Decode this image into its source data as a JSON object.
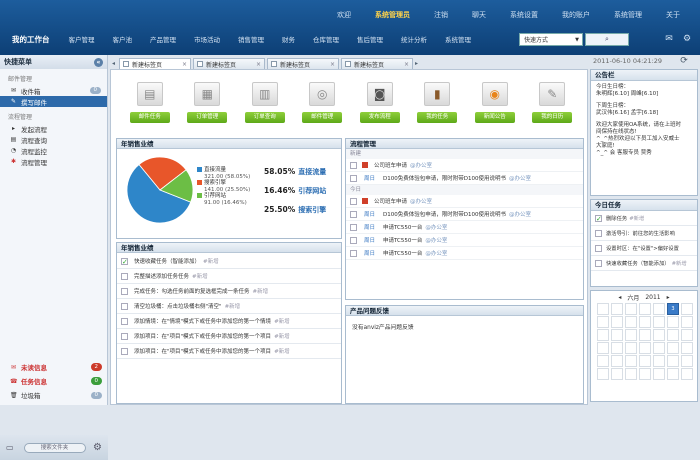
{
  "header": {
    "links": [
      "欢迎",
      "系统管理员",
      "注销",
      "聊天",
      "系统设置",
      "我的账户",
      "系统管理",
      "关于"
    ],
    "home_label": "我的工作台",
    "nav": [
      "客户管理",
      "客户池",
      "产品管理",
      "市场活动",
      "销售管理",
      "财务",
      "仓库管理",
      "售后管理",
      "统计分析",
      "系统管理"
    ],
    "search_mode": "快速方式"
  },
  "sidebar": {
    "title": "快捷菜单",
    "sections": [
      {
        "label": "邮件管理",
        "items": [
          {
            "label": "收件箱",
            "count": "0"
          },
          {
            "label": "撰写邮件"
          }
        ]
      },
      {
        "label": "流程管理",
        "items": [
          {
            "label": "发起流程"
          },
          {
            "label": "流程查询"
          },
          {
            "label": "流程监控"
          },
          {
            "label": "流程管理"
          }
        ]
      }
    ],
    "bottom": [
      {
        "label": "未读信息",
        "count": "2",
        "color": "#cc3a2a"
      },
      {
        "label": "任务信息",
        "count": "0",
        "color": "#3b9e3b"
      },
      {
        "label": "垃圾箱",
        "count": "0"
      }
    ],
    "foot_pill": "搜索文件夹"
  },
  "tabs": [
    "新建标签页",
    "新建标签页",
    "新建标签页",
    "新建标签页"
  ],
  "datetime": "2011-06-10 04:21:29",
  "quick_actions": [
    "邮件任务",
    "订单管理",
    "订单查询",
    "邮件管理",
    "发布流程",
    "我的任务",
    "新闻公告",
    "我的日历"
  ],
  "sales_panel": {
    "title": "年销售业绩",
    "legend": [
      {
        "name": "直接流量",
        "sub": "321.00 (58.05%)"
      },
      {
        "name": "搜索引擎",
        "sub": "141.00 (25.50%)"
      },
      {
        "name": "引荐网站",
        "sub": "91.00 (16.46%)"
      }
    ],
    "stats": [
      {
        "pct": "58.05%",
        "label": "直接流量"
      },
      {
        "pct": "16.46%",
        "label": "引荐网站"
      },
      {
        "pct": "25.50%",
        "label": "搜索引擎"
      }
    ]
  },
  "chart_data": {
    "type": "pie",
    "slices": [
      {
        "name": "直接流量",
        "value": 321,
        "color": "#2e86c9"
      },
      {
        "name": "搜索引擎",
        "value": 141,
        "color": "#e8562a"
      },
      {
        "name": "引荐网站",
        "value": 91,
        "color": "#6cbe45"
      }
    ]
  },
  "task_panel": {
    "title": "年销售业绩",
    "tasks": [
      {
        "text": "快速收藏任务（智能添加）",
        "tag": "#新增",
        "done": true
      },
      {
        "text": "完整描述添加任务任务",
        "tag": "#新增",
        "done": false
      },
      {
        "text": "完成任务：勾选任务前面的复选框完成一条任务",
        "tag": "#新增",
        "done": false
      },
      {
        "text": "清空垃圾桶：点击垃圾桶右侧\"清空\"",
        "tag": "#新增",
        "done": false
      },
      {
        "text": "添加情境：在\"情境\"模式下或任务中添加您的第一个情境",
        "tag": "#新增",
        "done": false
      },
      {
        "text": "添加项目：在\"项目\"模式下或任务中添加您的第一个项目",
        "tag": "#新增",
        "done": false
      },
      {
        "text": "添加项目：在\"项目\"模式下或任务中添加您的第一个项目",
        "tag": "#新增",
        "done": false
      }
    ]
  },
  "flow_panel": {
    "title": "流程管理",
    "group1": "新建",
    "group2": "今日",
    "rows": [
      {
        "date": "",
        "text": "公司班车申请",
        "tag": "@办公室",
        "flag": true
      },
      {
        "date": "周日",
        "text": "D100免费体验包申请，限时附带D100使用说明书",
        "tag": "@办公室",
        "flag": false
      },
      {
        "date": "",
        "text": "公司班车申请",
        "tag": "@办公室",
        "flag": true
      },
      {
        "date": "周日",
        "text": "D100免费体验包申请，限时附带D100使用说明书",
        "tag": "@办公室",
        "flag": false
      },
      {
        "date": "周日",
        "text": "申请TC550一台",
        "tag": "@办公室",
        "flag": false
      },
      {
        "date": "周日",
        "text": "申请TC550一台",
        "tag": "@办公室",
        "flag": false
      },
      {
        "date": "周日",
        "text": "申请TC550一台",
        "tag": "@办公室",
        "flag": false
      }
    ]
  },
  "feedback_panel": {
    "title": "产品问题反馈",
    "text": "没有anviz产品问题反馈"
  },
  "bulletin": {
    "title": "公告栏",
    "lines": [
      "今日生日榜：",
      "朱明辉[6.10] 周峰[6.10]",
      "",
      "下周生日榜：",
      "武汉伟[6.16] 孟宇[6.18]",
      "",
      "欢迎大家使用OA系统，请在上班时",
      "间保持在线状态!",
      "^_^热烈欢迎以下员工加入安威士",
      "大家庭!",
      "^_^ 会 客服专员 贾秀"
    ]
  },
  "today": {
    "title": "今日任务",
    "items": [
      {
        "text": "删除任务",
        "tag": "#新增",
        "done": true
      },
      {
        "text": "激活导引：前往您的生活影响",
        "tag": "",
        "done": false
      },
      {
        "text": "设置时区：在\"设置\">偏好设置",
        "tag": "",
        "done": false
      },
      {
        "text": "快速收藏任务（智能添加）",
        "tag": "#新增",
        "done": false
      }
    ]
  },
  "calendar": {
    "month": "六月",
    "year": "2011",
    "selected": "3"
  }
}
